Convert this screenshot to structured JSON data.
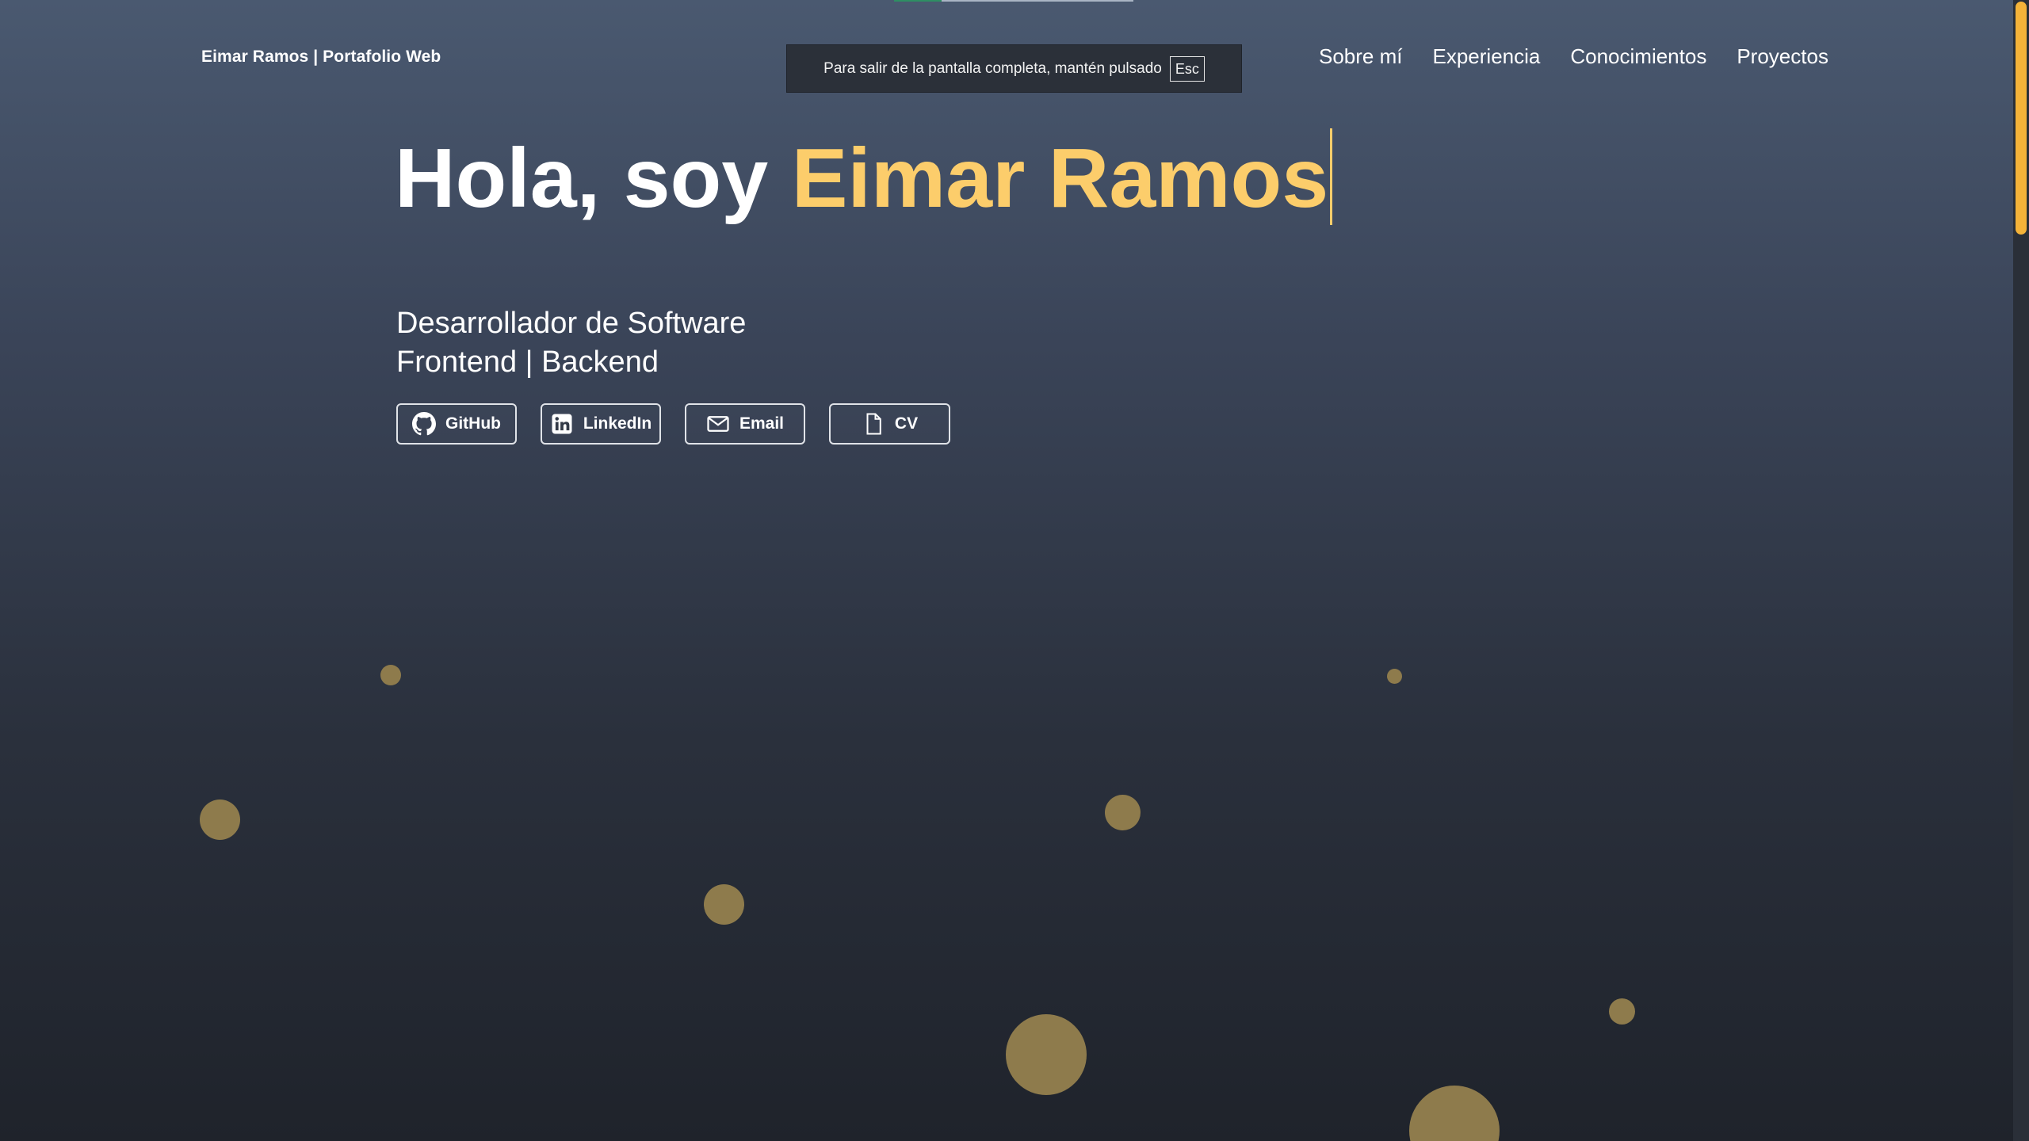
{
  "header": {
    "brand": "Eimar Ramos | Portafolio Web",
    "nav": [
      "Sobre mí",
      "Experiencia",
      "Conocimientos",
      "Proyectos"
    ]
  },
  "toast": {
    "message": "Para salir de la pantalla completa, mantén pulsado",
    "key": "Esc"
  },
  "hero": {
    "greeting": "Hola, soy",
    "name": "Eimar Ramos",
    "role_line1": "Desarrollador de Software",
    "role_line2": "Frontend | Backend"
  },
  "links": {
    "github": "GitHub",
    "linkedin": "LinkedIn",
    "email": "Email",
    "cv": "CV"
  },
  "colors": {
    "accent": "#fccd6b",
    "bubble": "#8e7b4c",
    "scroll_thumb": "#f5b339"
  },
  "icons": [
    "github-icon",
    "linkedin-icon",
    "mail-icon",
    "file-icon"
  ]
}
